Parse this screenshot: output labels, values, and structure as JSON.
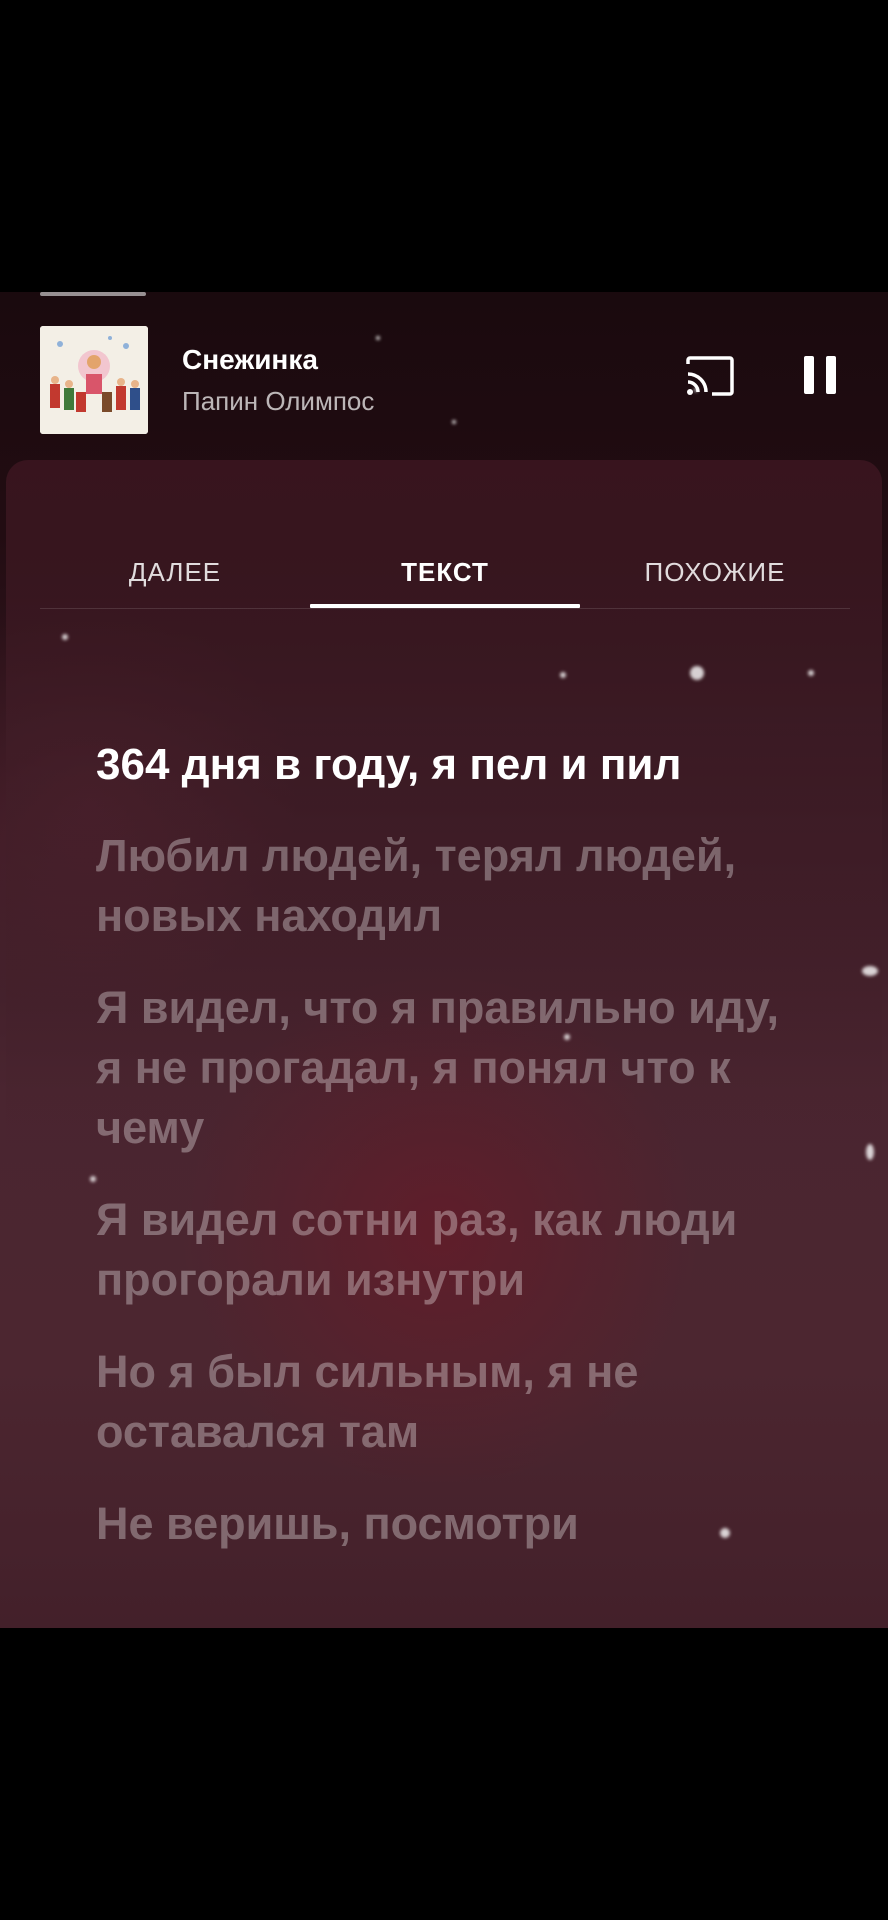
{
  "player": {
    "track_title": "Снежинка",
    "track_artist": "Папин Олимпос",
    "icons": [
      "cast-icon",
      "pause-icon"
    ]
  },
  "tabs": [
    {
      "label": "ДАЛЕЕ",
      "active": false
    },
    {
      "label": "ТЕКСТ",
      "active": true
    },
    {
      "label": "ПОХОЖИЕ",
      "active": false
    }
  ],
  "lyrics": [
    "364 дня в году, я пел и пил",
    "Любил людей, терял людей, новых находил",
    "Я видел, что я правильно иду, я не прогадал, я понял что к чему",
    "Я видел сотни раз, как люди прогорали изнутри",
    "Но я был сильным, я не оставался там",
    "Не веришь, посмотри"
  ],
  "colors": {
    "background": "#000000",
    "accent": "#ffffff",
    "sheet": "#4a2530"
  }
}
